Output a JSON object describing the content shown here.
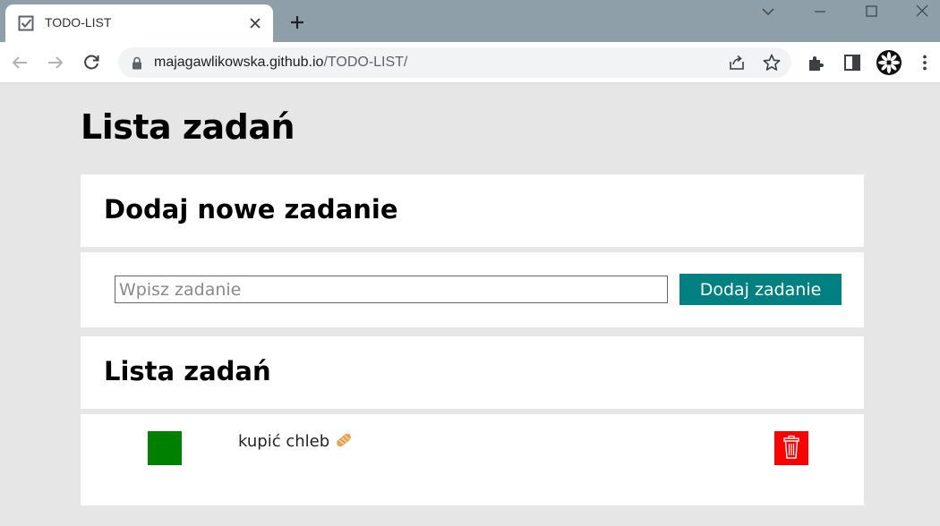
{
  "browser": {
    "tab_title": "TODO-LIST",
    "url_domain": "majagawlikowska.github.io",
    "url_path": "/TODO-LIST/"
  },
  "page": {
    "title": "Lista zadań",
    "add_section": {
      "heading": "Dodaj nowe zadanie",
      "input_placeholder": "Wpisz zadanie",
      "input_value": "",
      "button_label": "Dodaj zadanie"
    },
    "list_section": {
      "heading": "Lista zadań",
      "tasks": [
        {
          "text": "kupić chleb",
          "emoji": "bread-icon",
          "done": false
        }
      ]
    }
  },
  "colors": {
    "accent": "#008080",
    "done_button": "#008000",
    "remove_button": "#ff0000",
    "page_background": "#e6e6e6",
    "titlebar": "#8e9fa9"
  }
}
